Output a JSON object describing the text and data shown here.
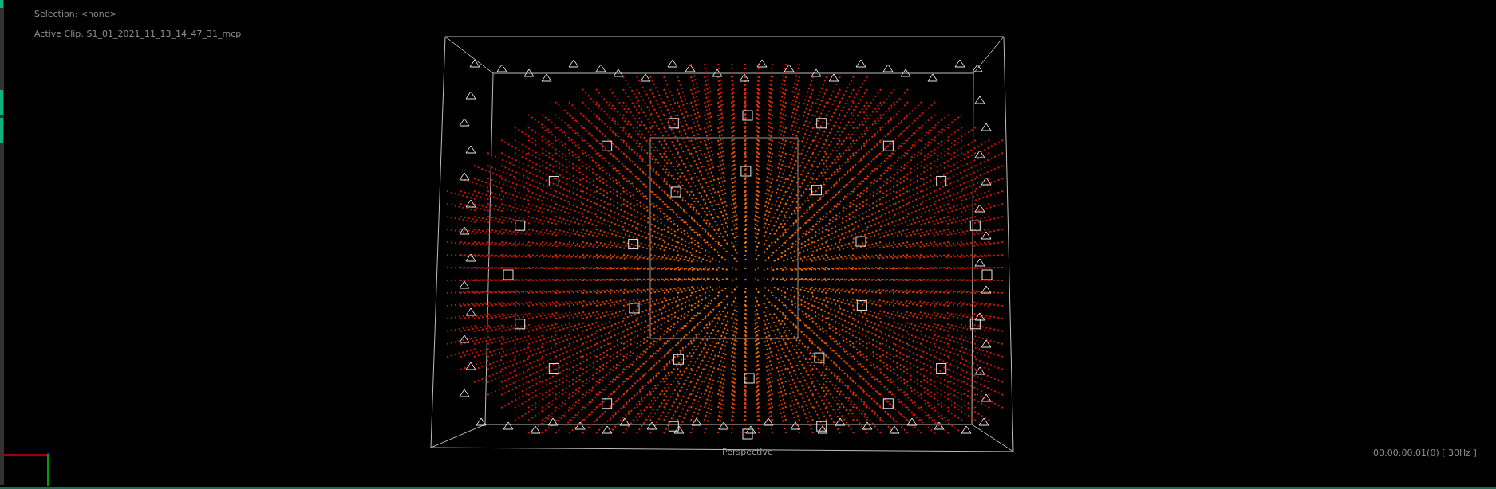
{
  "viewport": {
    "selection": "Selection: <none>",
    "active_clip": "Active Clip: S1_01_2021_11_13_14_47_31_mcp",
    "view_name": "Perspective",
    "timecode": "00:00:00:01(0) [ 30Hz ]"
  }
}
